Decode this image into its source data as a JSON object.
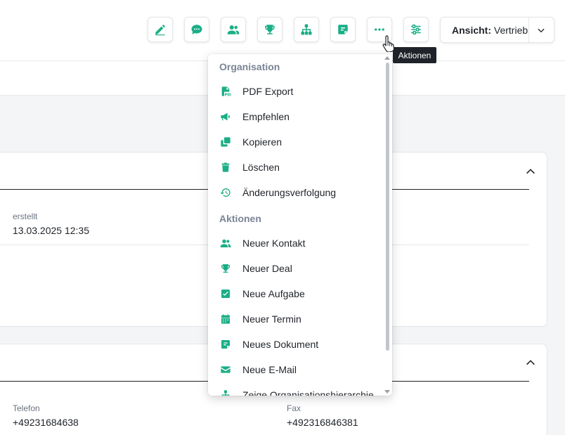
{
  "toolbar": {
    "buttons": [
      {
        "icon": "edit-icon"
      },
      {
        "icon": "comment-icon"
      },
      {
        "icon": "contacts-icon"
      },
      {
        "icon": "trophy-icon"
      },
      {
        "icon": "hierarchy-icon"
      },
      {
        "icon": "document-icon"
      },
      {
        "icon": "more-icon"
      },
      {
        "icon": "sliders-icon"
      }
    ],
    "view_prefix": "Ansicht:",
    "view_value": "Vertrieb",
    "tooltip": "Aktionen"
  },
  "menu": {
    "section1": "Organisation",
    "section2": "Aktionen",
    "items1": [
      {
        "label": "PDF Export",
        "icon": "pdf-icon"
      },
      {
        "label": "Empfehlen",
        "icon": "megaphone-icon"
      },
      {
        "label": "Kopieren",
        "icon": "copy-icon"
      },
      {
        "label": "Löschen",
        "icon": "trash-icon"
      },
      {
        "label": "Änderungsverfolgung",
        "icon": "history-icon"
      }
    ],
    "items2": [
      {
        "label": "Neuer Kontakt",
        "icon": "contacts-icon"
      },
      {
        "label": "Neuer Deal",
        "icon": "trophy-icon"
      },
      {
        "label": "Neue Aufgabe",
        "icon": "task-icon"
      },
      {
        "label": "Neuer Termin",
        "icon": "calendar-icon"
      },
      {
        "label": "Neues Dokument",
        "icon": "document-icon"
      },
      {
        "label": "Neue E-Mail",
        "icon": "email-icon"
      },
      {
        "label": "Zeige Organisationshierarchie",
        "icon": "hierarchy-icon"
      }
    ]
  },
  "card1": {
    "created_label": "erstellt",
    "created_value": "13.03.2025 12:35"
  },
  "card2": {
    "phone_label": "Telefon",
    "phone_value": "+49231684638",
    "fax_label": "Fax",
    "fax_value": "+492316846381"
  },
  "colors": {
    "accent": "#1aae86",
    "text": "#1f2329",
    "muted": "#6b7280",
    "tooltip_bg": "#1f2329"
  }
}
